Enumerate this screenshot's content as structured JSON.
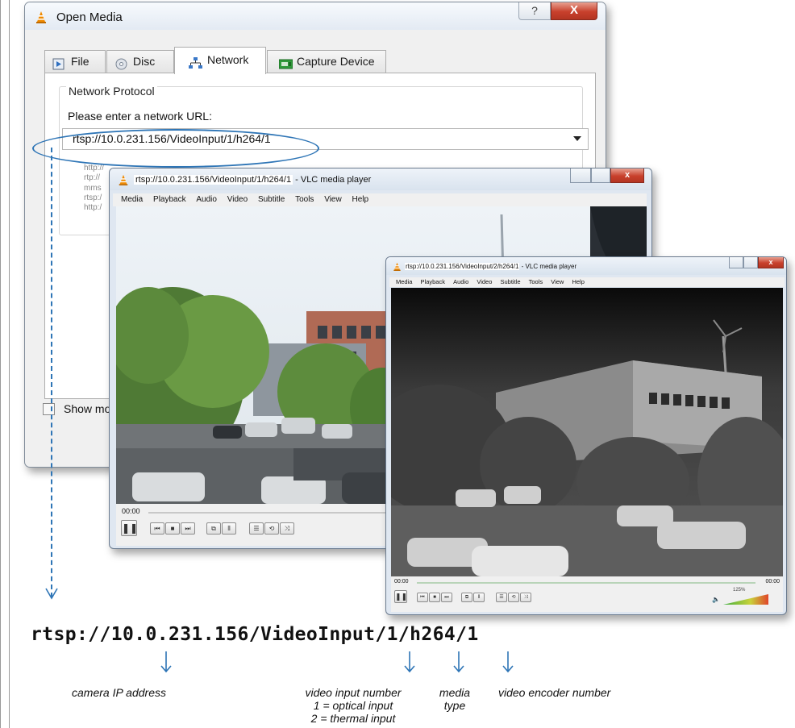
{
  "dialog": {
    "title": "Open Media",
    "help_glyph": "?",
    "close_glyph": "X",
    "tabs": [
      {
        "label": "File",
        "icon": "file-play-icon"
      },
      {
        "label": "Disc",
        "icon": "disc-icon"
      },
      {
        "label": "Network",
        "icon": "network-icon",
        "active": true
      },
      {
        "label": "Capture Device",
        "icon": "capture-device-icon"
      }
    ],
    "group_title": "Network Protocol",
    "url_prompt": "Please enter a network URL:",
    "url_value": "rtsp://10.0.231.156/VideoInput/1/h264/1",
    "examples": [
      "http://",
      "rtp://",
      "mms",
      "rtsp:/",
      "http:/"
    ],
    "show_more_label": "Show mo"
  },
  "vlc1": {
    "title_url": "rtsp://10.0.231.156/VideoInput/1/h264/1",
    "title_suffix": " - VLC media player",
    "menu": [
      "Media",
      "Playback",
      "Audio",
      "Video",
      "Subtitle",
      "Tools",
      "View",
      "Help"
    ],
    "time_elapsed": "00:00"
  },
  "vlc2": {
    "title_url": "rtsp://10.0.231.156/VideoInput/2/h264/1",
    "title_suffix": " - VLC media player",
    "menu": [
      "Media",
      "Playback",
      "Audio",
      "Video",
      "Subtitle",
      "Tools",
      "View",
      "Help"
    ],
    "time_elapsed": "00:00",
    "time_total": "00:00",
    "volume": "125%"
  },
  "annotation": {
    "url": "rtsp://10.0.231.156/VideoInput/1/h264/1",
    "camera_ip_label": "camera IP address",
    "video_input_label": "video input number",
    "video_input_line1": "1 = optical input",
    "video_input_line2": "2 = thermal input",
    "media_type_label_1": "media",
    "media_type_label_2": "type",
    "encoder_label": "video encoder number"
  },
  "colors": {
    "annotation_blue": "#2e75b6",
    "vlc_orange": "#f08a00",
    "close_red": "#c8402c"
  }
}
